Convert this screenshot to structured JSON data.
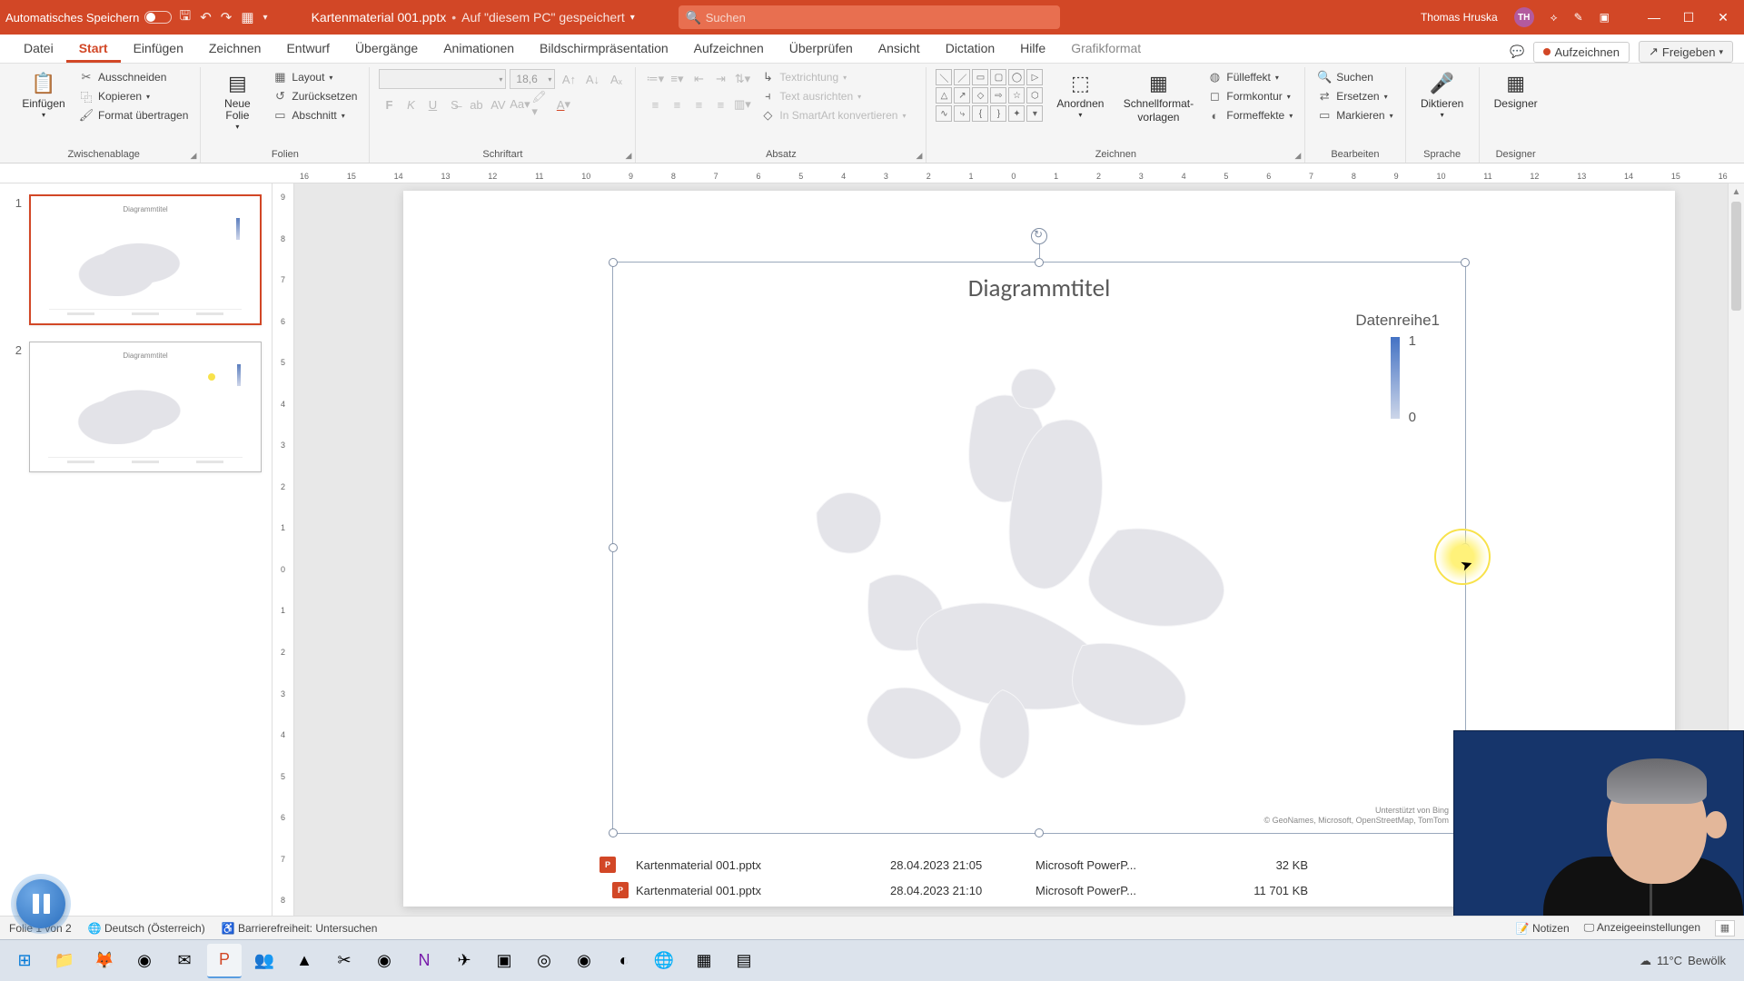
{
  "titlebar": {
    "autosave_label": "Automatisches Speichern",
    "doc_name": "Kartenmaterial 001.pptx",
    "saved_location": "Auf \"diesem PC\" gespeichert",
    "search_placeholder": "Suchen",
    "user_name": "Thomas Hruska",
    "user_initials": "TH"
  },
  "ribbon_tabs": {
    "items": [
      "Datei",
      "Start",
      "Einfügen",
      "Zeichnen",
      "Entwurf",
      "Übergänge",
      "Animationen",
      "Bildschirmpräsentation",
      "Aufzeichnen",
      "Überprüfen",
      "Ansicht",
      "Dictation",
      "Hilfe",
      "Grafikformat"
    ],
    "active": "Start",
    "record": "Aufzeichnen",
    "share": "Freigeben"
  },
  "ribbon": {
    "clipboard": {
      "paste": "Einfügen",
      "cut": "Ausschneiden",
      "copy": "Kopieren",
      "format_painter": "Format übertragen",
      "label": "Zwischenablage"
    },
    "slides": {
      "new_slide": "Neue Folie",
      "layout": "Layout",
      "reset": "Zurücksetzen",
      "section": "Abschnitt",
      "label": "Folien"
    },
    "font": {
      "size": "18,6",
      "label": "Schriftart"
    },
    "paragraph": {
      "text_direction": "Textrichtung",
      "align_text": "Text ausrichten",
      "smartart": "In SmartArt konvertieren",
      "label": "Absatz"
    },
    "drawing": {
      "arrange": "Anordnen",
      "quick_styles_1": "Schnellformat-",
      "quick_styles_2": "vorlagen",
      "fill": "Fülleffekt",
      "outline": "Formkontur",
      "effects": "Formeffekte",
      "label": "Zeichnen"
    },
    "editing": {
      "find": "Suchen",
      "replace": "Ersetzen",
      "select": "Markieren",
      "label": "Bearbeiten"
    },
    "voice": {
      "dictate": "Diktieren",
      "label": "Sprache"
    },
    "designer": {
      "btn": "Designer",
      "label": "Designer"
    }
  },
  "ruler_h": [
    "16",
    "15",
    "14",
    "13",
    "12",
    "11",
    "10",
    "9",
    "8",
    "7",
    "6",
    "5",
    "4",
    "3",
    "2",
    "1",
    "0",
    "1",
    "2",
    "3",
    "4",
    "5",
    "6",
    "7",
    "8",
    "9",
    "10",
    "11",
    "12",
    "13",
    "14",
    "15",
    "16"
  ],
  "ruler_v": [
    "9",
    "8",
    "7",
    "6",
    "5",
    "4",
    "3",
    "2",
    "1",
    "0",
    "1",
    "2",
    "3",
    "4",
    "5",
    "6",
    "7",
    "8",
    "9"
  ],
  "thumbnails": {
    "slide1_num": "1",
    "slide2_num": "2"
  },
  "chart": {
    "title": "Diagrammtitel",
    "series_name": "Datenreihe1",
    "legend_max": "1",
    "legend_min": "0",
    "attrib_line1": "Unterstützt von Bing",
    "attrib_line2": "© GeoNames, Microsoft, OpenStreetMap, TomTom"
  },
  "chart_data": {
    "type": "map",
    "title": "Diagrammtitel",
    "series": [
      {
        "name": "Datenreihe1",
        "color_scale": {
          "min": 0,
          "max": 1,
          "min_color": "#cdd6e9",
          "max_color": "#4472c4"
        }
      }
    ],
    "region": "Europe",
    "data_points": [],
    "note": "No country values are visually encoded; map shows uniform light grey fill."
  },
  "file_list": {
    "rows": [
      {
        "name": "Kartenmaterial 001.pptx",
        "date": "28.04.2023 21:05",
        "type": "Microsoft PowerP...",
        "size": "32 KB"
      },
      {
        "name": "Kartenmaterial 001.pptx",
        "date": "28.04.2023 21:10",
        "type": "Microsoft PowerP...",
        "size": "11 701 KB"
      }
    ]
  },
  "statusbar": {
    "slide_info": "Folie 1 von 2",
    "language": "Deutsch (Österreich)",
    "accessibility": "Barrierefreiheit: Untersuchen",
    "notes": "Notizen",
    "display_settings": "Anzeigeeinstellungen"
  },
  "taskbar": {
    "weather_temp": "11°C",
    "weather_cond": "Bewölk"
  }
}
